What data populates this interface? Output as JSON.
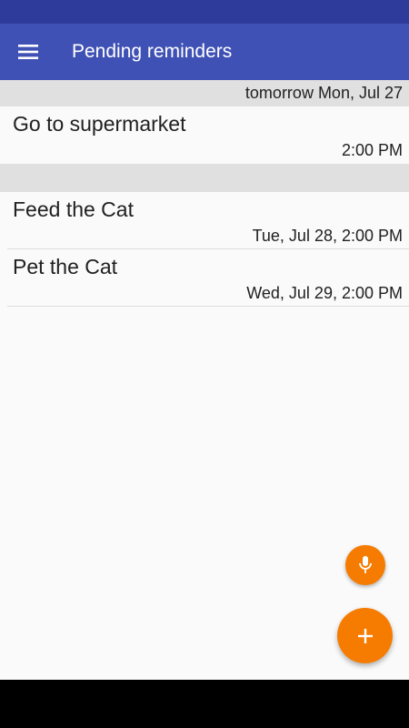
{
  "app_bar": {
    "title": "Pending reminders",
    "menu_icon": "hamburger-menu-icon",
    "background": "#3f51b5"
  },
  "sections": [
    {
      "header": "tomorrow Mon, Jul 27",
      "items": [
        {
          "title": "Go to supermarket",
          "time": "2:00 PM"
        }
      ]
    },
    {
      "header": "",
      "items": [
        {
          "title": "Feed the Cat",
          "time": "Tue, Jul 28, 2:00 PM"
        },
        {
          "title": "Pet the Cat",
          "time": "Wed, Jul 29, 2:00 PM"
        }
      ]
    }
  ],
  "fabs": {
    "mic_icon": "microphone-icon",
    "add_icon": "plus-icon",
    "color": "#f57c00"
  }
}
